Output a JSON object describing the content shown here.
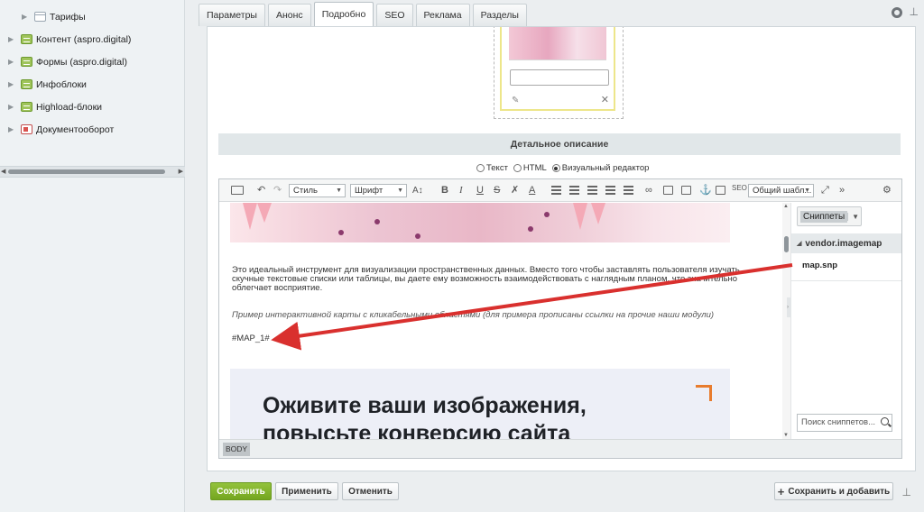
{
  "sidebar": {
    "items": [
      {
        "label": "Тарифы",
        "icon": "table-icon"
      },
      {
        "label": "Контент (aspro.digital)",
        "icon": "iblock-icon"
      },
      {
        "label": "Формы (aspro.digital)",
        "icon": "iblock-icon"
      },
      {
        "label": "Инфоблоки",
        "icon": "iblock-icon"
      },
      {
        "label": "Highload-блоки",
        "icon": "iblock-icon"
      },
      {
        "label": "Документооборот",
        "icon": "document-icon"
      }
    ]
  },
  "tabs": [
    "Параметры",
    "Анонс",
    "Подробно",
    "SEO",
    "Реклама",
    "Разделы"
  ],
  "active_tab": "Подробно",
  "section_title": "Детальное описание",
  "modes": {
    "text": "Текст",
    "html": "HTML",
    "visual": "Визуальный редактор",
    "selected": "visual"
  },
  "toolbar": {
    "style": "Стиль",
    "font": "Шрифт",
    "template": "Общий шабл..."
  },
  "content": {
    "para1": "Это идеальный инструмент для визуализации пространственных данных. Вместо того чтобы заставлять пользователя изучать скучные текстовые списки или таблицы, вы даете ему возможность взаимодействовать с наглядным планом, что значительно облегчает восприятие.",
    "para2": "Пример интерактивной карты с кликабельными областями (для примера прописаны ссылки на прочие наши модули)",
    "macro": "#MAP_1#",
    "banner_title": "Оживите ваши изображения, повысьте конверсию сайта"
  },
  "statusbar": {
    "tag": "BODY"
  },
  "snippets": {
    "button": "Сниппеты",
    "group": "vendor.imagemap",
    "item": "map.snp",
    "search_placeholder": "Поиск сниппетов..."
  },
  "buttons": {
    "save": "Сохранить",
    "apply": "Применить",
    "cancel": "Отменить",
    "save_add": "Сохранить и добавить"
  },
  "colors": {
    "accent_green": "#7aae25",
    "arrow_red": "#d9302e",
    "banner_corner": "#e87c2e"
  }
}
